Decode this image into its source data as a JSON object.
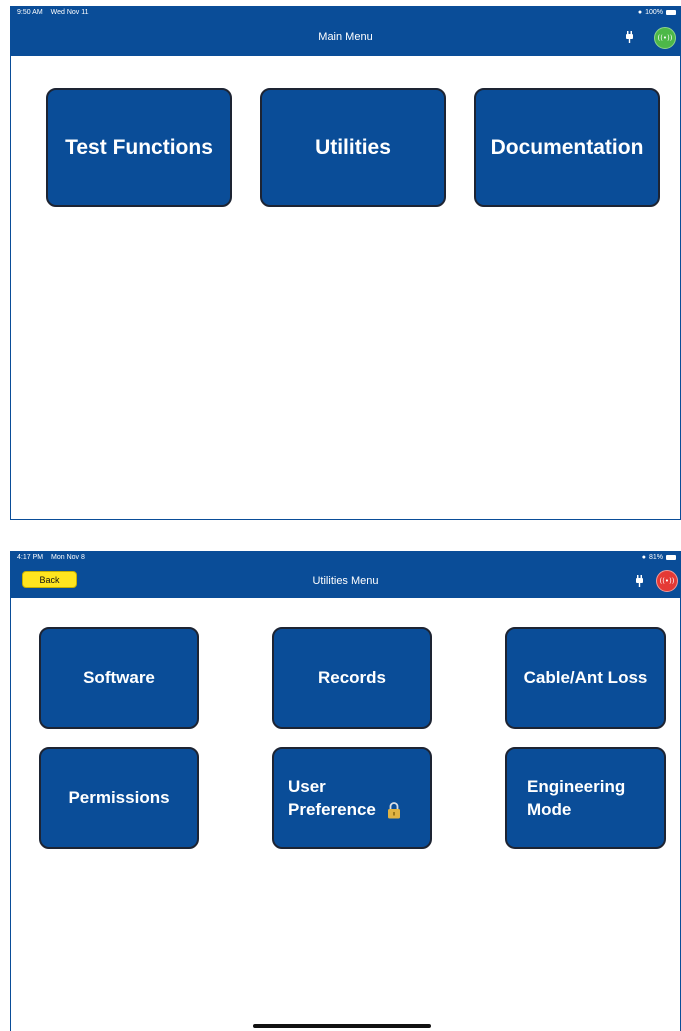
{
  "screen1": {
    "status": {
      "time": "9:50 AM",
      "date": "Wed Nov 11",
      "battery": "100%"
    },
    "nav_title": "Main Menu",
    "connection_status_color": "#4db848",
    "tiles": [
      {
        "label": "Test Functions"
      },
      {
        "label": "Utilities"
      },
      {
        "label": "Documentation"
      }
    ]
  },
  "screen2": {
    "status": {
      "time": "4:17 PM",
      "date": "Mon Nov 8",
      "battery": "81%"
    },
    "back_label": "Back",
    "nav_title": "Utilities Menu",
    "connection_status_color": "#e53935",
    "tiles": [
      {
        "label": "Software"
      },
      {
        "label": "Records"
      },
      {
        "label": "Cable/Ant Loss"
      },
      {
        "label": "Permissions"
      },
      {
        "line1": "User",
        "line2": "Preference",
        "icon": "lock-icon"
      },
      {
        "line1": "Engineering",
        "line2": "Mode"
      }
    ]
  },
  "colors": {
    "brand_blue": "#0a4d98",
    "back_yellow": "#ffe51f"
  }
}
